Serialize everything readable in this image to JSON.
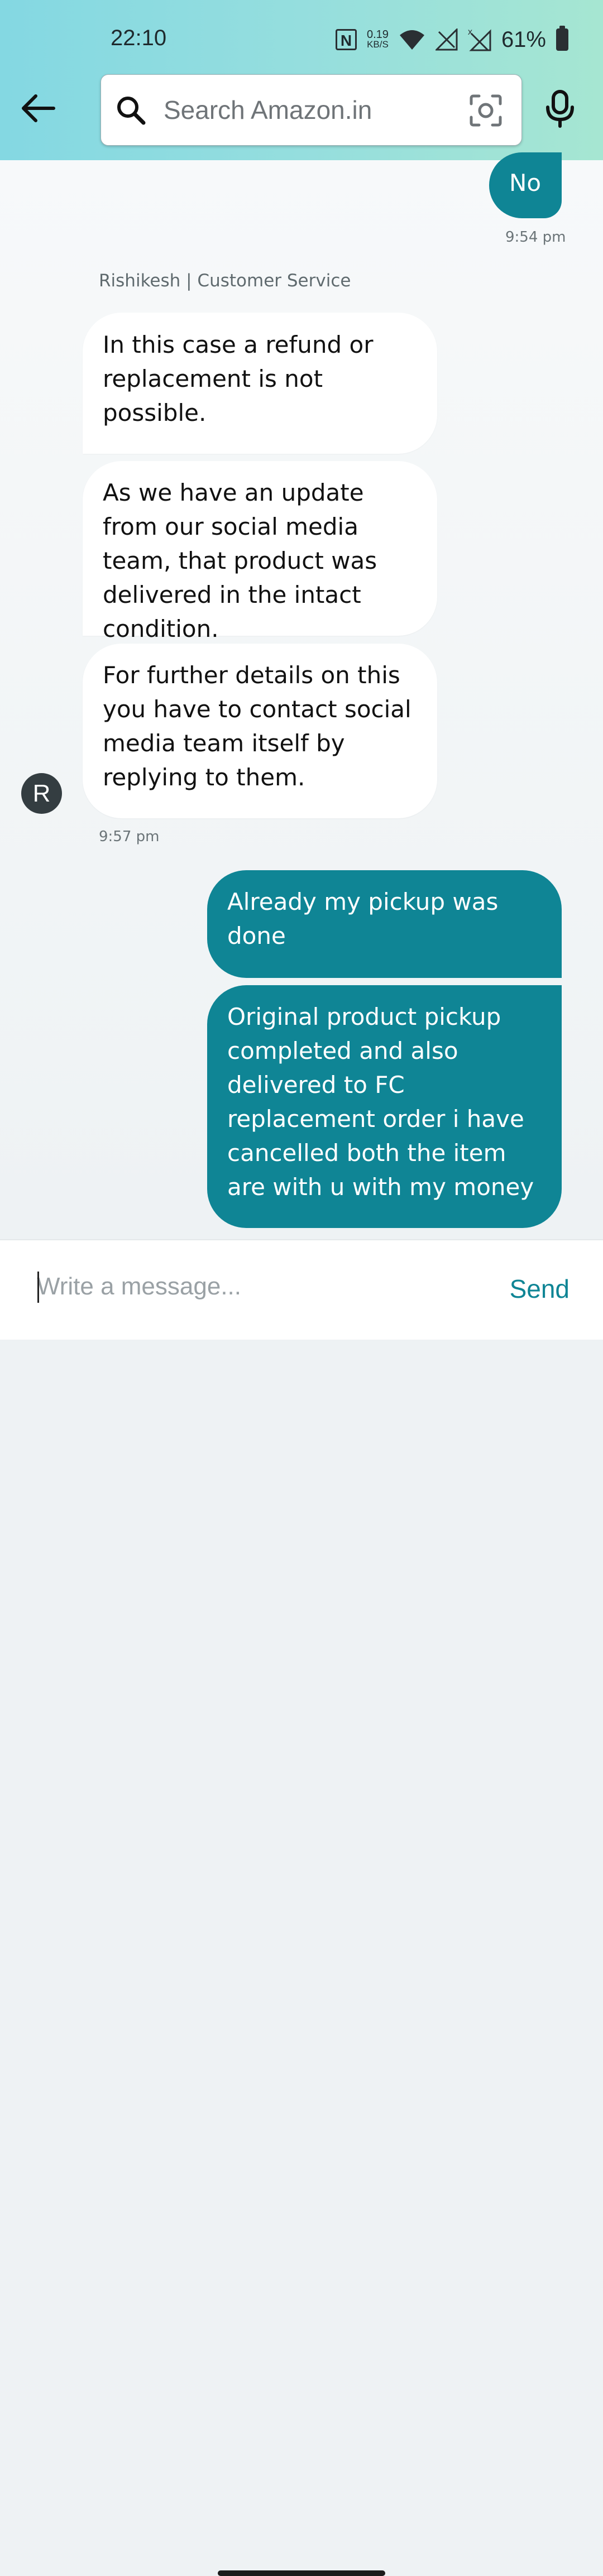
{
  "status_bar": {
    "time": "22:10",
    "net_speed_value": "0.19",
    "net_speed_unit": "KB/S",
    "battery": "61%"
  },
  "header": {
    "search_placeholder": "Search Amazon.in"
  },
  "chat": {
    "messages": [
      {
        "direction": "outgoing",
        "text": "No"
      },
      {
        "direction": "outgoing_time",
        "text": "9:54 pm"
      },
      {
        "direction": "agent_label",
        "text": "Rishikesh | Customer Service"
      },
      {
        "direction": "incoming",
        "text": "In this case a refund or replacement is not possible."
      },
      {
        "direction": "incoming",
        "text": "As we have an update from our social media team, that product was delivered in the intact condition."
      },
      {
        "direction": "incoming",
        "text": "For further details on this you have to contact social media team itself by replying to them."
      },
      {
        "direction": "incoming_time",
        "text": "9:57 pm"
      },
      {
        "direction": "outgoing",
        "text": "Already my pickup was done"
      },
      {
        "direction": "outgoing",
        "text": "Original product pickup completed and also delivered to FC replacement order i have cancelled both the item are with u with my money"
      }
    ],
    "agent_avatar_letter": "R"
  },
  "composer": {
    "placeholder": "Write a message...",
    "send_label": "Send"
  },
  "colors": {
    "accent": "#0f8595",
    "header_gradient_start": "#84d8e2",
    "header_gradient_end": "#a6e6d2"
  },
  "icons": [
    "back-arrow-icon",
    "search-icon",
    "camera-icon",
    "mic-icon",
    "nfc-icon",
    "wifi-icon",
    "signal-icon",
    "battery-icon"
  ]
}
